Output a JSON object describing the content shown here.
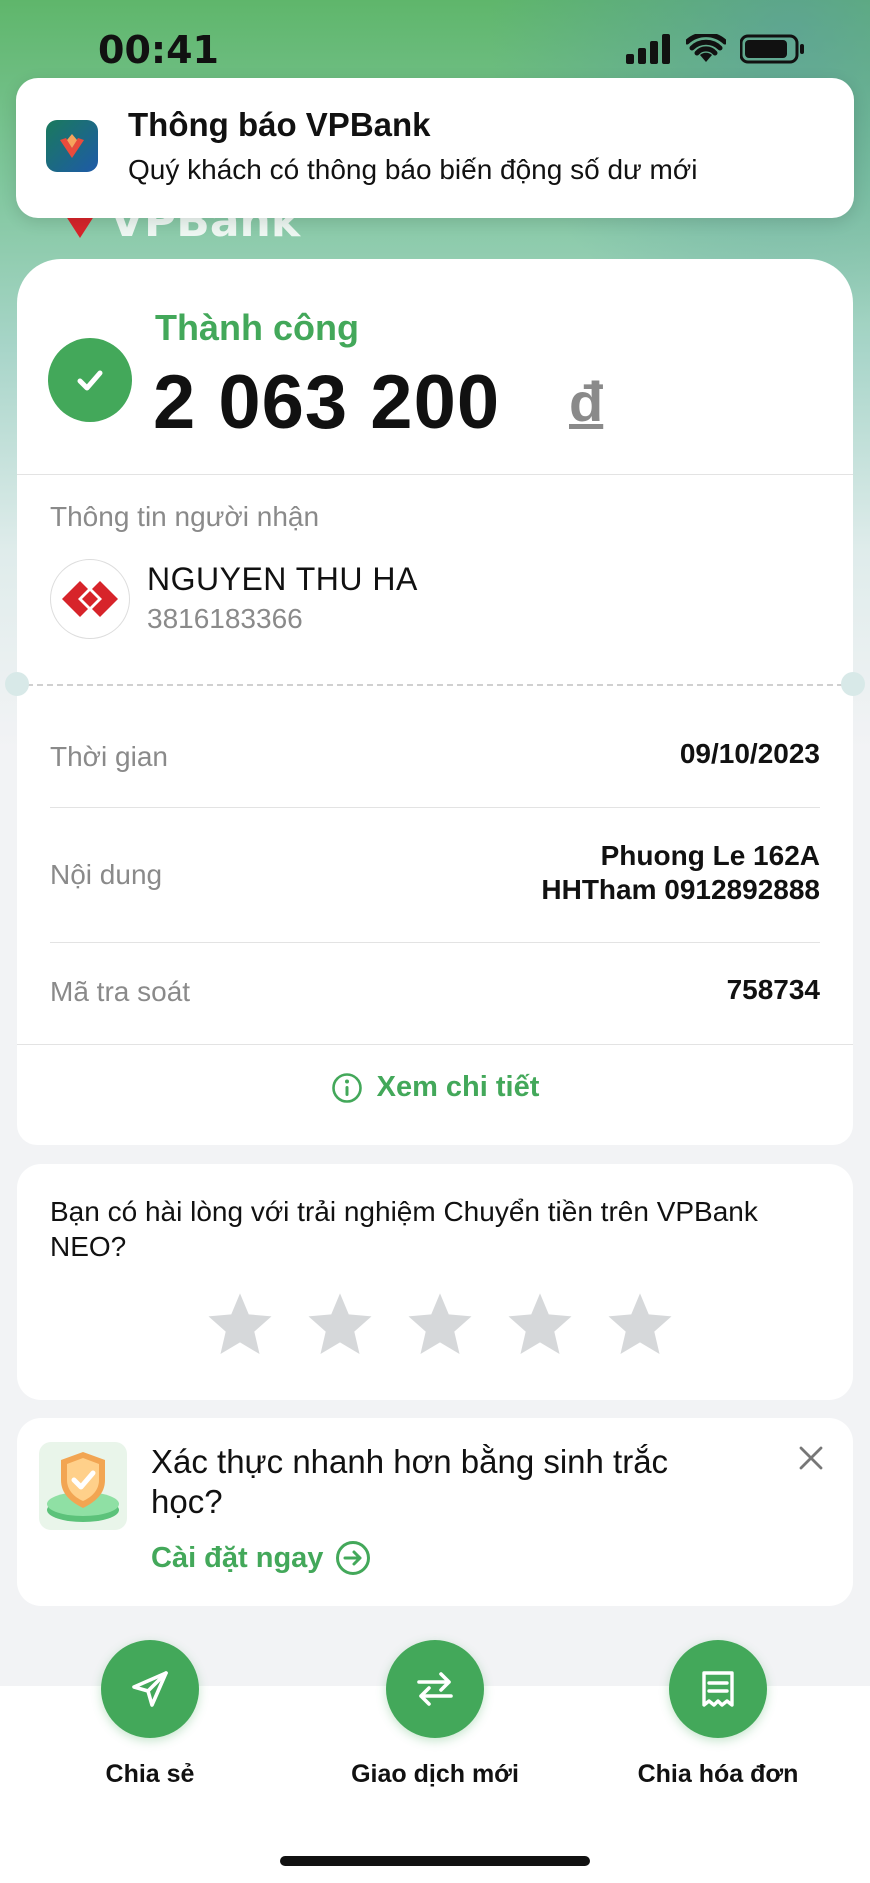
{
  "status": {
    "time": "00:41"
  },
  "background": {
    "logo_text": "VPBank"
  },
  "notification": {
    "title": "Thông báo VPBank",
    "body": "Quý khách có thông báo biến động số dư mới"
  },
  "result": {
    "status_label": "Thành công",
    "amount": "2 063 200",
    "currency": "đ"
  },
  "recipient": {
    "caption": "Thông tin người nhận",
    "name": "NGUYEN THU HA",
    "account": "3816183366"
  },
  "details": [
    {
      "label": "Thời gian",
      "value_lines": [
        "09/10/2023"
      ]
    },
    {
      "label": "Nội dung",
      "value_lines": [
        "Phuong Le 162A",
        "HHTham 0912892888"
      ]
    },
    {
      "label": "Mã tra soát",
      "value_lines": [
        "758734"
      ]
    }
  ],
  "detail_link": "Xem chi tiết",
  "rating": {
    "question": "Bạn có hài lòng với trải nghiệm Chuyển tiền trên VPBank NEO?",
    "stars_total": 5,
    "stars_selected": 0
  },
  "biometric": {
    "title": "Xác thực nhanh hơn bằng sinh trắc học?",
    "link": "Cài đặt ngay"
  },
  "actions": [
    {
      "label": "Chia sẻ",
      "icon": "send-icon"
    },
    {
      "label": "Giao dịch mới",
      "icon": "swap-icon"
    },
    {
      "label": "Chia hóa đơn",
      "icon": "receipt-icon"
    }
  ],
  "colors": {
    "brand_green": "#43a85a",
    "muted_text": "#8a8a8a",
    "brand_red": "#d7242a"
  }
}
